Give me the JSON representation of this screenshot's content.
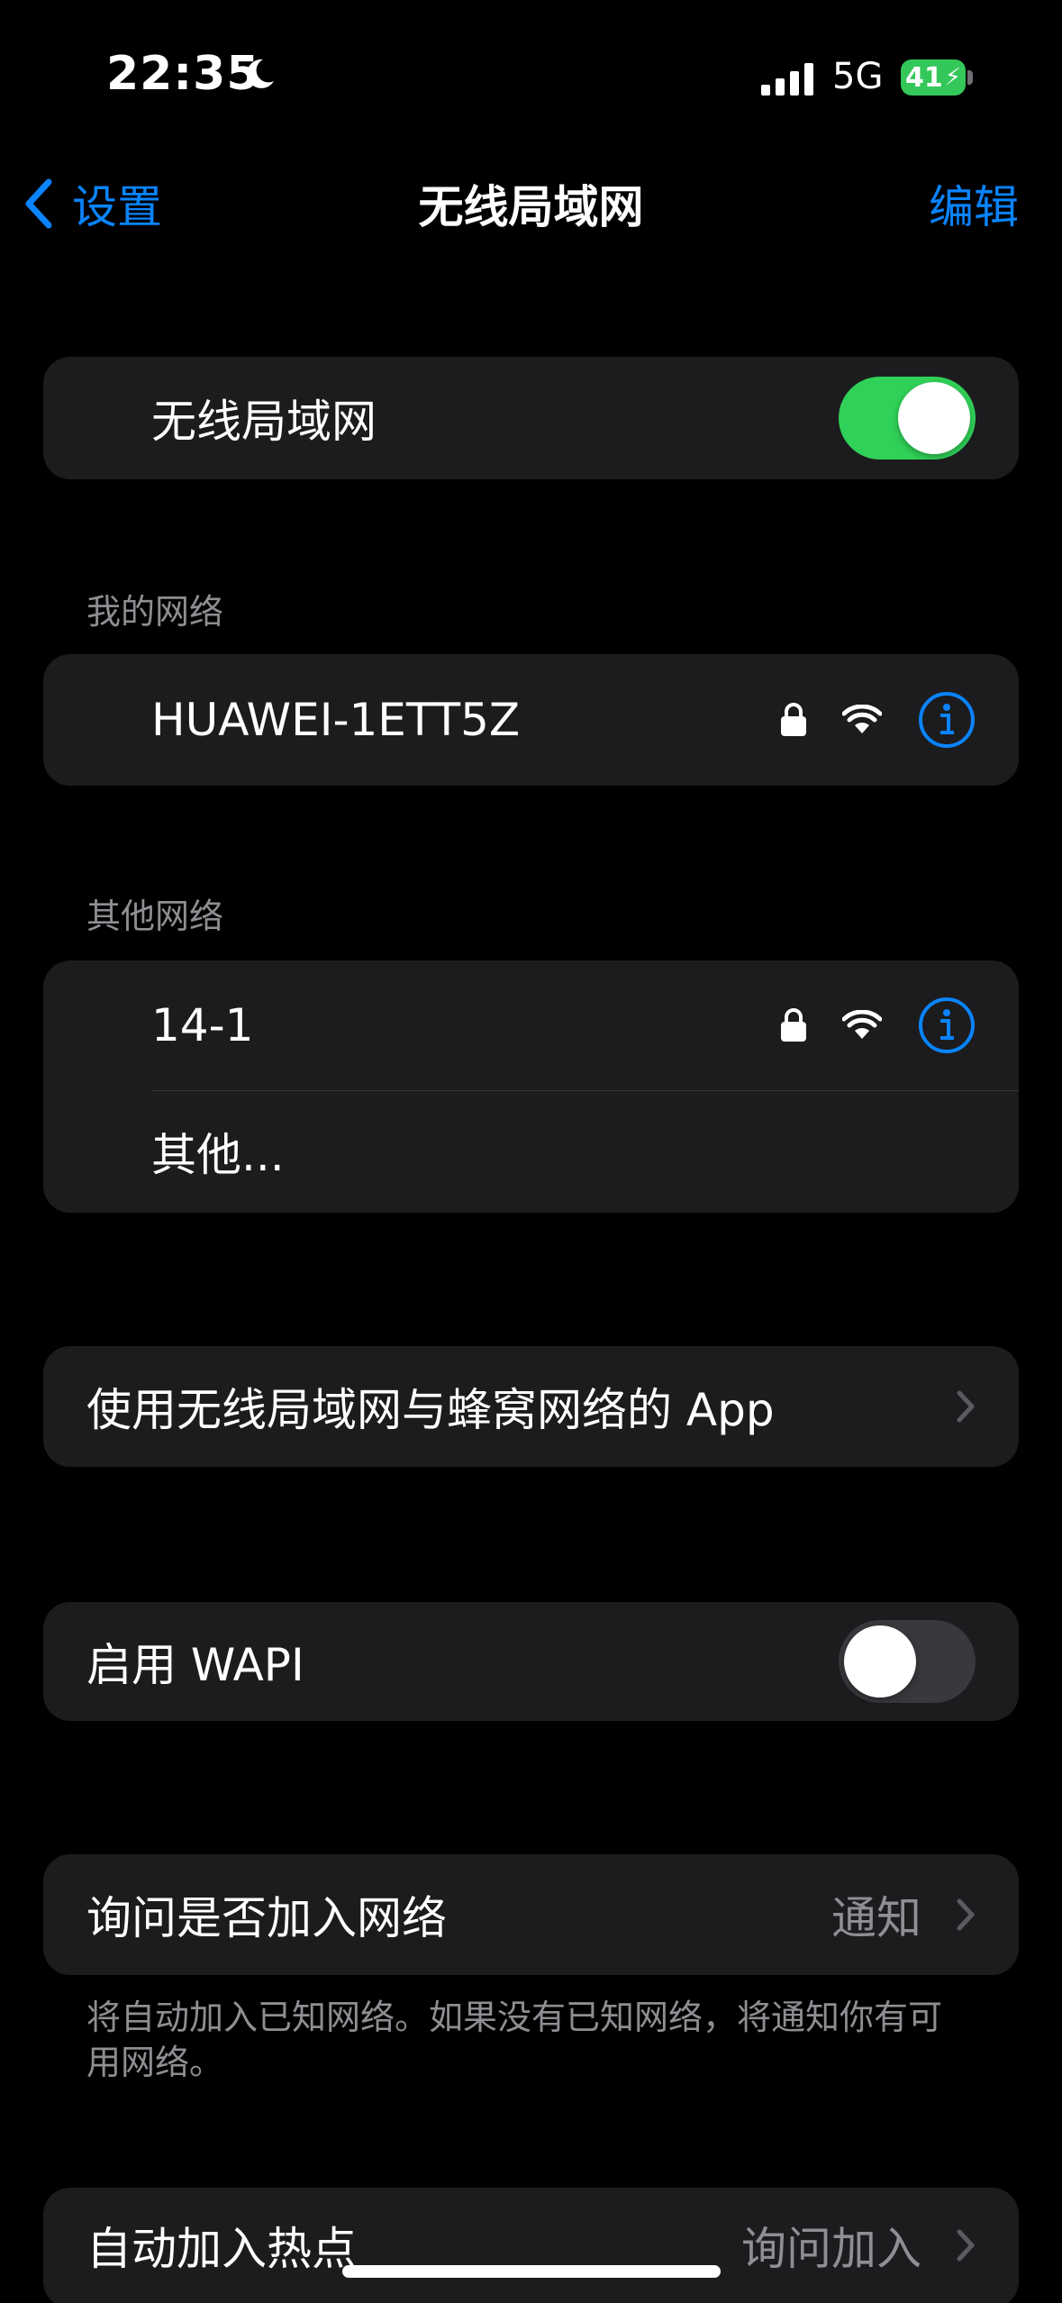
{
  "status_bar": {
    "time": "22:35",
    "network": "5G",
    "battery": "41"
  },
  "nav": {
    "back_label": "设置",
    "title": "无线局域网",
    "edit_label": "编辑"
  },
  "wifi_toggle": {
    "label": "无线局域网",
    "on": true
  },
  "my_networks": {
    "header": "我的网络",
    "items": [
      {
        "name": "HUAWEI-1ETT5Z",
        "secured": true
      }
    ]
  },
  "other_networks": {
    "header": "其他网络",
    "items": [
      {
        "name": "14-1",
        "secured": true
      }
    ],
    "other_label": "其他..."
  },
  "apps_row": {
    "label": "使用无线局域网与蜂窝网络的 App"
  },
  "wapi_toggle": {
    "label": "启用 WAPI",
    "on": false
  },
  "ask_join": {
    "label": "询问是否加入网络",
    "value": "通知",
    "footer": "将自动加入已知网络。如果没有已知网络，将通知你有可用网络。"
  },
  "auto_hotspot": {
    "label": "自动加入热点",
    "value": "询问加入"
  },
  "colors": {
    "accent": "#0a84ff",
    "toggle_on": "#30d158",
    "cell_bg": "#1c1c1e",
    "secondary_text": "#8e8e93"
  }
}
